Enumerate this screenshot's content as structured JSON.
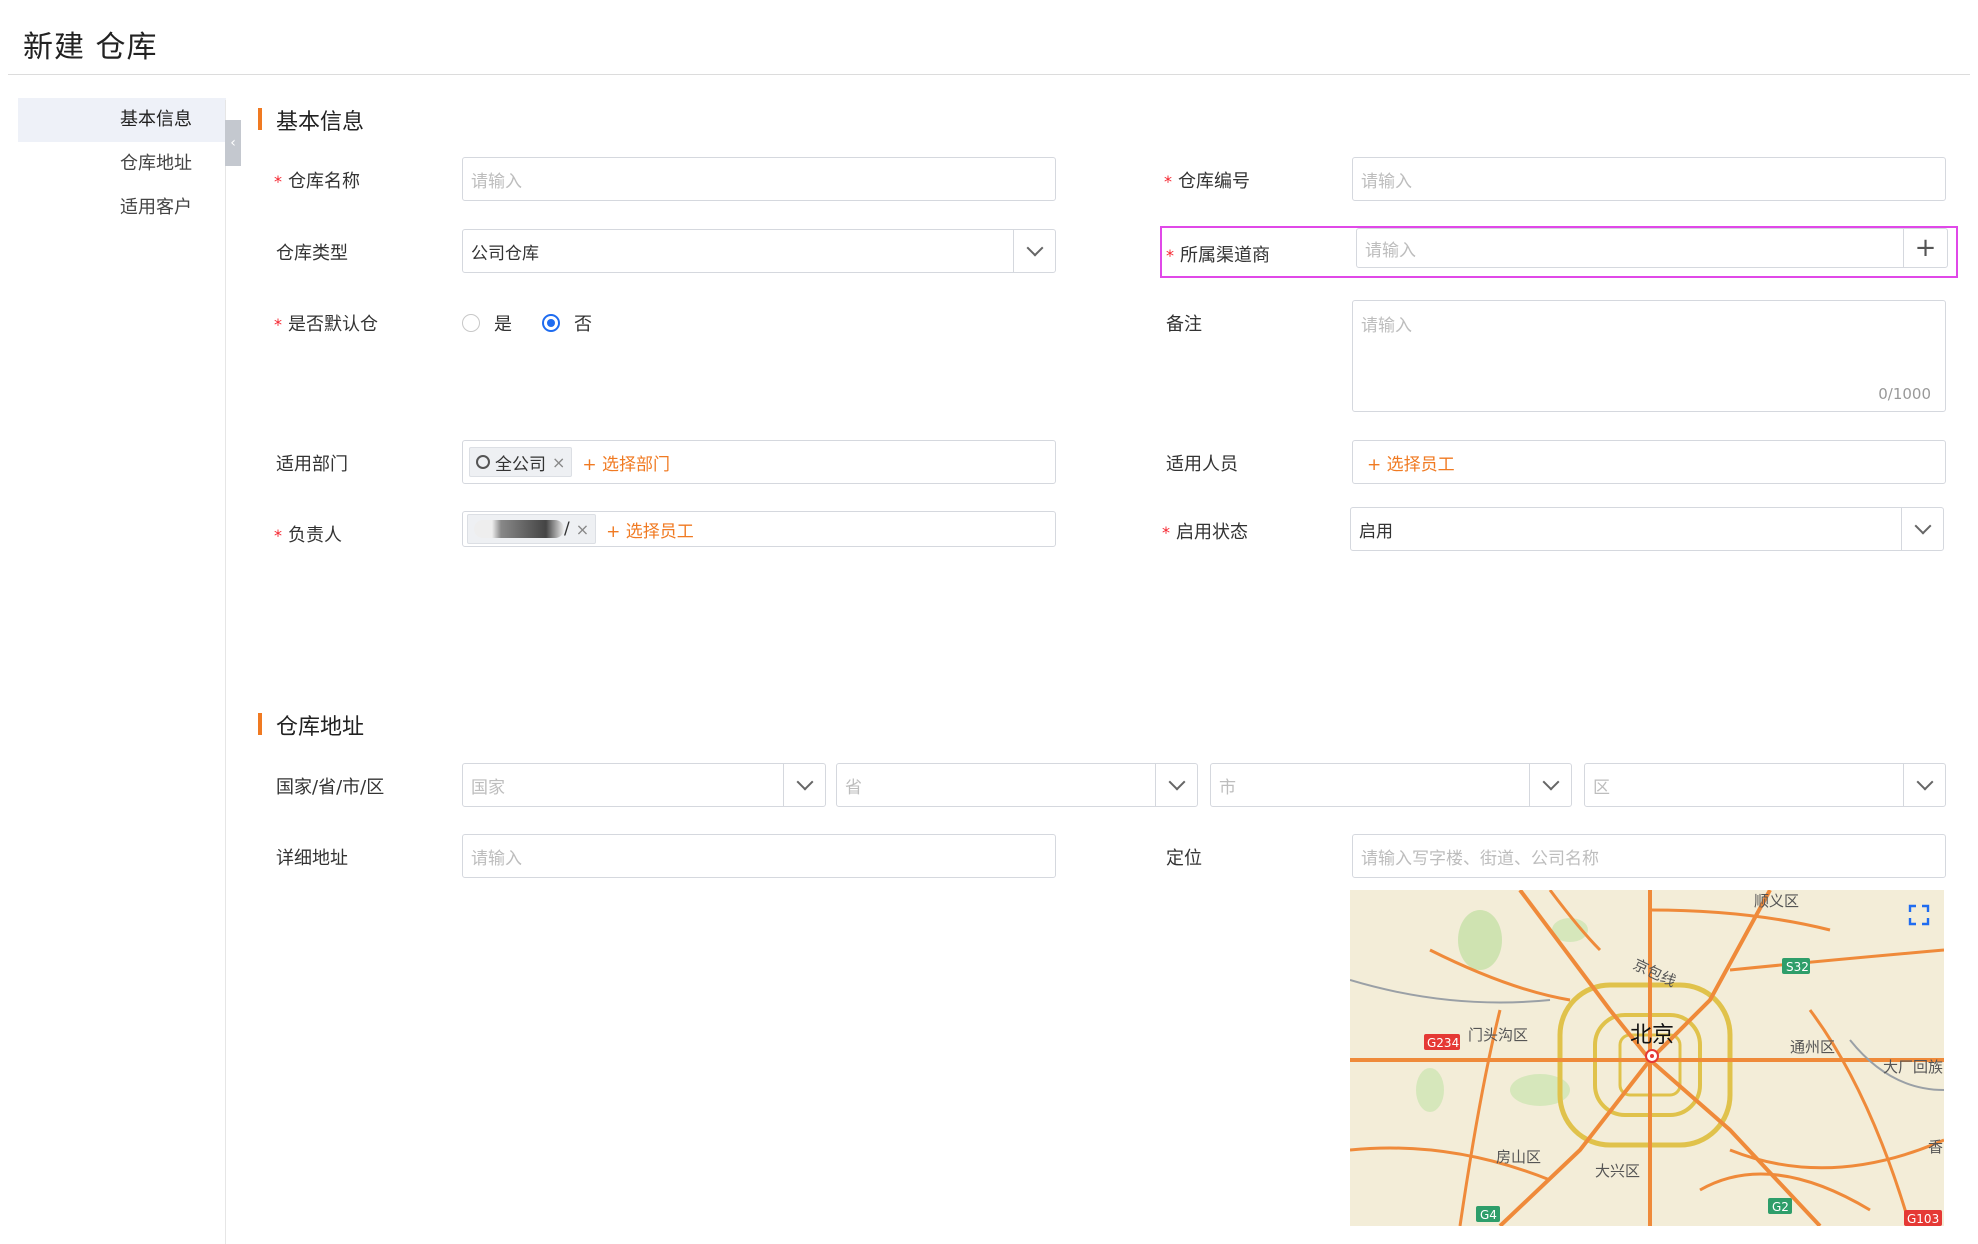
{
  "page": {
    "title": "新建 仓库"
  },
  "sidebar": {
    "items": [
      {
        "label": "基本信息",
        "active": true
      },
      {
        "label": "仓库地址",
        "active": false
      },
      {
        "label": "适用客户",
        "active": false
      }
    ],
    "collapse_icon": "chevron-left-icon"
  },
  "basic": {
    "heading": "基本信息",
    "warehouse_name": {
      "label": "仓库名称",
      "required": true,
      "placeholder": "请输入"
    },
    "warehouse_code": {
      "label": "仓库编号",
      "required": true,
      "placeholder": "请输入"
    },
    "warehouse_type": {
      "label": "仓库类型",
      "value": "公司仓库"
    },
    "channel": {
      "label": "所属渠道商",
      "required": true,
      "placeholder": "请输入",
      "add_symbol": "+"
    },
    "is_default": {
      "label": "是否默认仓",
      "required": true,
      "options": [
        "是",
        "否"
      ],
      "selected": "否"
    },
    "remark": {
      "label": "备注",
      "placeholder": "请输入",
      "counter": "0/1000"
    },
    "department": {
      "label": "适用部门",
      "tag": "全公司",
      "add_label": "+ 选择部门"
    },
    "personnel": {
      "label": "适用人员",
      "add_label": "+ 选择员工"
    },
    "owner": {
      "label": "负责人",
      "required": true,
      "tag_suffix": "/",
      "add_label": "+ 选择员工"
    },
    "status": {
      "label": "启用状态",
      "required": true,
      "value": "启用"
    }
  },
  "address": {
    "heading": "仓库地址",
    "region": {
      "label": "国家/省/市/区",
      "country_placeholder": "国家",
      "province_placeholder": "省",
      "city_placeholder": "市",
      "district_placeholder": "区"
    },
    "detail": {
      "label": "详细地址",
      "placeholder": "请输入"
    },
    "location": {
      "label": "定位",
      "placeholder": "请输入写字楼、街道、公司名称"
    }
  },
  "map": {
    "labels": {
      "city": "北京",
      "shunyi": "顺义区",
      "mentougou": "门头沟区",
      "tongzhou": "通州区",
      "fangshan": "房山区",
      "daxing": "大兴区",
      "dachang": "大厂回族",
      "xianghe": "香",
      "jingbao": "京包线",
      "g234": "G234",
      "s32": "S32",
      "g4": "G4",
      "g2": "G2",
      "g103": "G103"
    },
    "fullscreen_icon": "fullscreen-icon",
    "marker_icon": "location-pin-icon"
  },
  "colors": {
    "accent": "#f07a22",
    "required": "#f5222d",
    "radio": "#1f6cf0",
    "highlight": "#e048e8"
  }
}
